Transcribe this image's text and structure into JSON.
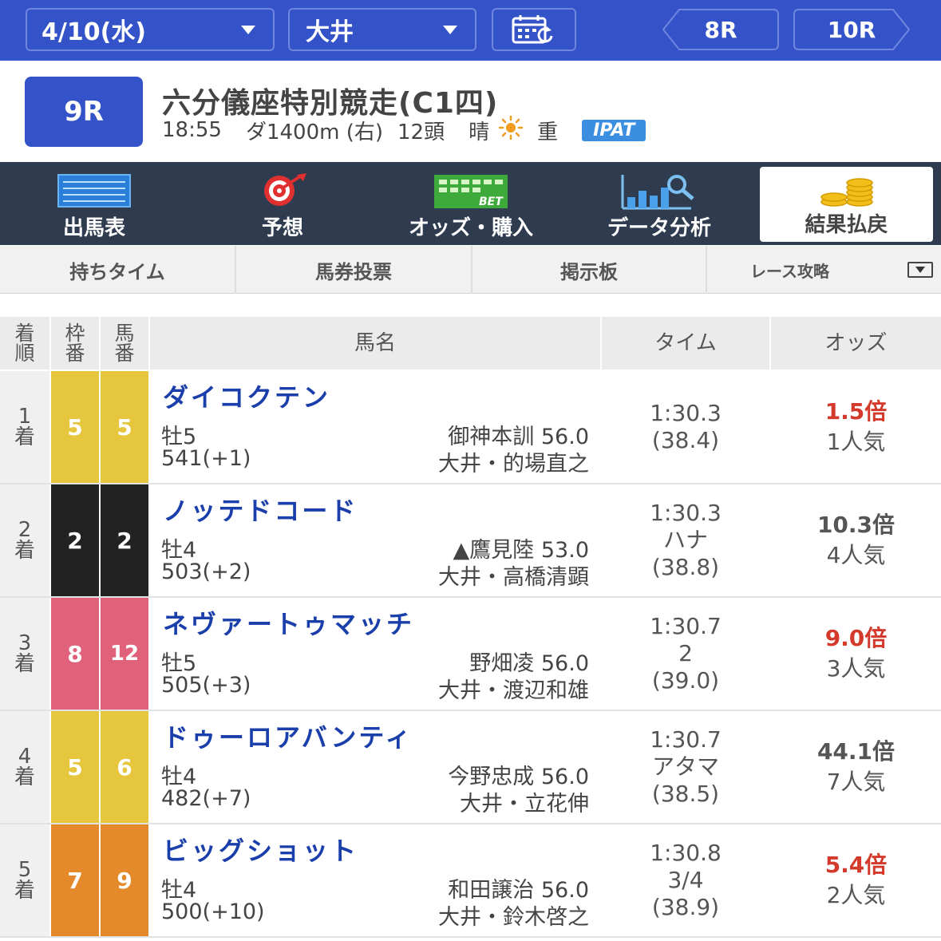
{
  "topbar": {
    "date": "4/10(水)",
    "venue": "大井",
    "prev_race": "8R",
    "next_race": "10R"
  },
  "race": {
    "number": "9R",
    "title": "六分儀座特別競走(C1四)",
    "start_time": "18:55",
    "course": "ダ1400m (右)",
    "runners": "12頭",
    "weather": "晴",
    "track_condition": "重",
    "betting_label": "IPAT"
  },
  "main_nav": [
    {
      "label": "出馬表",
      "icon": "entry-table-icon"
    },
    {
      "label": "予想",
      "icon": "target-icon"
    },
    {
      "label": "オッズ・購入",
      "icon": "bet-icon"
    },
    {
      "label": "データ分析",
      "icon": "analytics-icon"
    },
    {
      "label": "結果払戻",
      "icon": "coins-icon",
      "active": true
    }
  ],
  "sub_tabs": [
    "持ちタイム",
    "馬券投票",
    "掲示板",
    "レース攻略"
  ],
  "table": {
    "headers": {
      "rank": [
        "着",
        "順"
      ],
      "waku": [
        "枠",
        "番"
      ],
      "uma": [
        "馬",
        "番"
      ],
      "name": "馬名",
      "time": "タイム",
      "odds": "オッズ"
    },
    "rows": [
      {
        "rank": "1",
        "rank_suffix": "着",
        "waku": "5",
        "uma": "5",
        "waku_bg": "#e6c63c",
        "waku_fg": "#ffffff",
        "name": "ダイコクテン",
        "sex_age": "牡5",
        "weight": "541(+1)",
        "jockey": "御神本訓 56.0",
        "trainer": "大井・的場直之",
        "time": "1:30.3",
        "margin": "",
        "last3f": "(38.4)",
        "odds": "1.5倍",
        "popularity": "1人気",
        "odds_color": "#d33a2c"
      },
      {
        "rank": "2",
        "rank_suffix": "着",
        "waku": "2",
        "uma": "2",
        "waku_bg": "#222222",
        "waku_fg": "#ffffff",
        "name": "ノッテドコード",
        "sex_age": "牡4",
        "weight": "503(+2)",
        "jockey": "▲鷹見陸 53.0",
        "trainer": "大井・高橋清顕",
        "time": "1:30.3",
        "margin": "ハナ",
        "last3f": "(38.8)",
        "odds": "10.3倍",
        "popularity": "4人気",
        "odds_color": "#555555"
      },
      {
        "rank": "3",
        "rank_suffix": "着",
        "waku": "8",
        "uma": "12",
        "waku_bg": "#e0617a",
        "waku_fg": "#ffffff",
        "name": "ネヴァートゥマッチ",
        "sex_age": "牡5",
        "weight": "505(+3)",
        "jockey": "野畑凌 56.0",
        "trainer": "大井・渡辺和雄",
        "time": "1:30.7",
        "margin": "2",
        "last3f": "(39.0)",
        "odds": "9.0倍",
        "popularity": "3人気",
        "odds_color": "#d33a2c"
      },
      {
        "rank": "4",
        "rank_suffix": "着",
        "waku": "5",
        "uma": "6",
        "waku_bg": "#e6c63c",
        "waku_fg": "#ffffff",
        "name": "ドゥーロアバンティ",
        "sex_age": "牡4",
        "weight": "482(+7)",
        "jockey": "今野忠成 56.0",
        "trainer": "大井・立花伸",
        "time": "1:30.7",
        "margin": "アタマ",
        "last3f": "(38.5)",
        "odds": "44.1倍",
        "popularity": "7人気",
        "odds_color": "#555555"
      },
      {
        "rank": "5",
        "rank_suffix": "着",
        "waku": "7",
        "uma": "9",
        "waku_bg": "#e58a2a",
        "waku_fg": "#ffffff",
        "name": "ビッグショット",
        "sex_age": "牡4",
        "weight": "500(+10)",
        "jockey": "和田譲治 56.0",
        "trainer": "大井・鈴木啓之",
        "time": "1:30.8",
        "margin": "3/4",
        "last3f": "(38.9)",
        "odds": "5.4倍",
        "popularity": "2人気",
        "odds_color": "#d33a2c"
      }
    ]
  },
  "colors": {
    "accent": "#3553c9",
    "nav_bg": "#2f3c4f",
    "horse_name": "#1b3faa",
    "favorite_odds": "#d33a2c"
  }
}
